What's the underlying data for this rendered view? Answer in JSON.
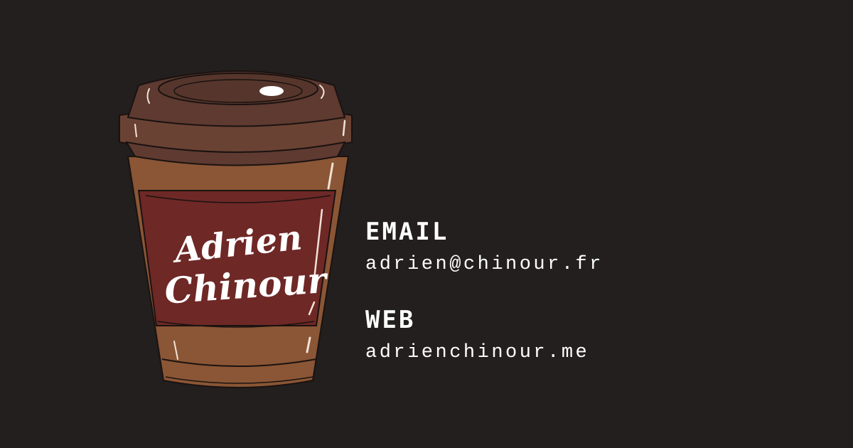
{
  "brand": {
    "name_line1": "Adrien",
    "name_line2": "Chinour"
  },
  "contact": {
    "email_label": "EMAIL",
    "email_value": "adrien@chinour.fr",
    "web_label": "WEB",
    "web_value": "adrienchinour.me"
  },
  "colors": {
    "background": "#231f1f",
    "lid": "#5e3a30",
    "cup_body": "#8a5635",
    "sleeve": "#6e2826",
    "text": "#ffffff"
  },
  "icons": {
    "illustration": "coffee-cup-icon"
  }
}
